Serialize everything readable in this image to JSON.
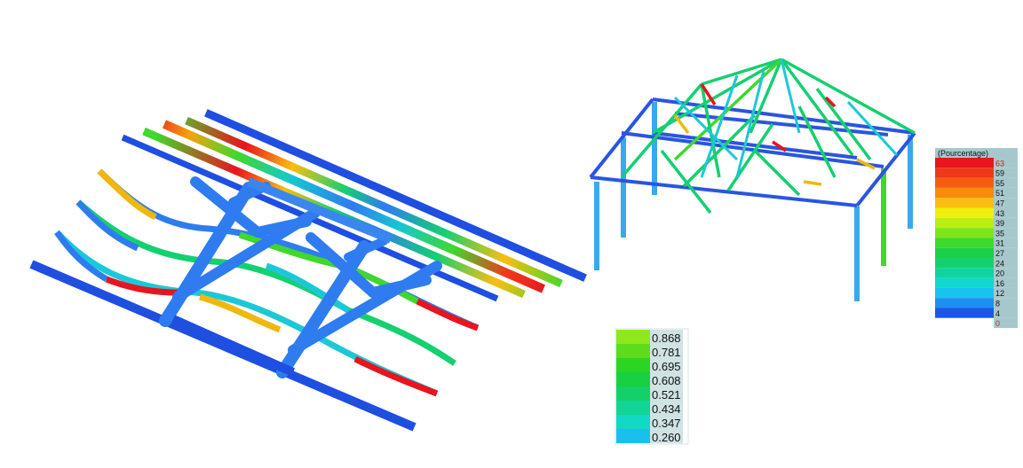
{
  "scale_percent": {
    "title": "(Pourcentage)",
    "entries": [
      {
        "label": "63",
        "color": "#e8141e",
        "label_color": "#d4141e"
      },
      {
        "label": "59",
        "color": "#f0381a",
        "label_color": "#111111"
      },
      {
        "label": "55",
        "color": "#f55d12",
        "label_color": "#111111"
      },
      {
        "label": "51",
        "color": "#f88a0c",
        "label_color": "#111111"
      },
      {
        "label": "47",
        "color": "#fbbd10",
        "label_color": "#111111"
      },
      {
        "label": "43",
        "color": "#eef00c",
        "label_color": "#111111"
      },
      {
        "label": "39",
        "color": "#b8ee14",
        "label_color": "#111111"
      },
      {
        "label": "35",
        "color": "#7fe41c",
        "label_color": "#111111"
      },
      {
        "label": "31",
        "color": "#3fd82c",
        "label_color": "#111111"
      },
      {
        "label": "27",
        "color": "#1ccf48",
        "label_color": "#111111"
      },
      {
        "label": "24",
        "color": "#14d070",
        "label_color": "#111111"
      },
      {
        "label": "20",
        "color": "#10d4a0",
        "label_color": "#111111"
      },
      {
        "label": "16",
        "color": "#10d8cc",
        "label_color": "#111111"
      },
      {
        "label": "12",
        "color": "#18c4ee",
        "label_color": "#111111"
      },
      {
        "label": "8",
        "color": "#208ef0",
        "label_color": "#111111"
      },
      {
        "label": "4",
        "color": "#1c58e8",
        "label_color": "#111111"
      },
      {
        "label": "0",
        "color": "#ffffff",
        "label_color": "#e8141e"
      }
    ]
  },
  "scale_ratio": {
    "entries": [
      {
        "label": "0.868",
        "color": "#8ee81c"
      },
      {
        "label": "0.781",
        "color": "#5cdc1c"
      },
      {
        "label": "0.695",
        "color": "#2cd424"
      },
      {
        "label": "0.608",
        "color": "#18d040"
      },
      {
        "label": "0.521",
        "color": "#14d068"
      },
      {
        "label": "0.434",
        "color": "#12d494"
      },
      {
        "label": "0.347",
        "color": "#12d8c4"
      },
      {
        "label": "0.260",
        "color": "#1ac0ec"
      }
    ]
  },
  "colors": {
    "beam_blue": "#1f4fe0",
    "frame_blue": "#2f6ef0",
    "column_cyan": "#3aa8ee",
    "legend_header_bg": "#a6c8cc"
  }
}
